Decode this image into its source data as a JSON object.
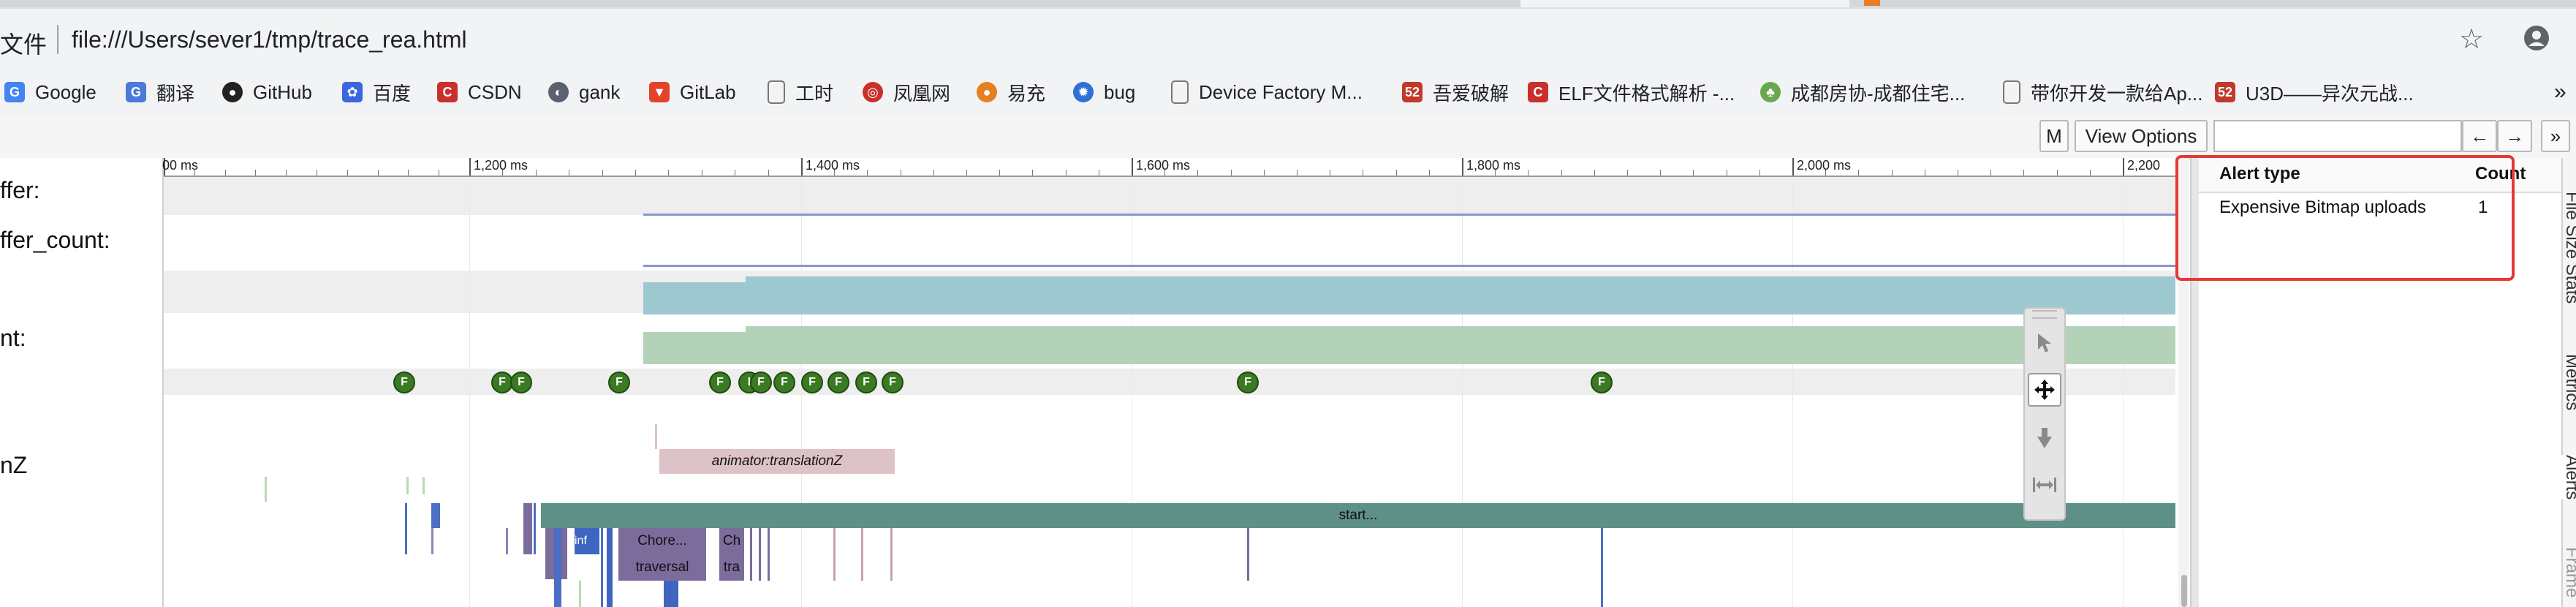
{
  "browser": {
    "address_prefix": "文件",
    "url": "file:///Users/sever1/tmp/trace_rea.html",
    "icons": [
      "star-icon",
      "account-icon",
      "more-icon"
    ]
  },
  "bookmarks": [
    {
      "label": "Google",
      "icon": "google-icon",
      "color": "#4285f4"
    },
    {
      "label": "翻译",
      "icon": "translate-icon",
      "color": "#4a7bd8"
    },
    {
      "label": "GitHub",
      "icon": "github-icon",
      "color": "#222222"
    },
    {
      "label": "百度",
      "icon": "baidu-icon",
      "color": "#3b66e0"
    },
    {
      "label": "CSDN",
      "icon": "csdn-icon",
      "color": "#c9302c"
    },
    {
      "label": "gank",
      "icon": "gank-icon",
      "color": "#5b6170"
    },
    {
      "label": "GitLab",
      "icon": "gitlab-icon",
      "color": "#e24329"
    },
    {
      "label": "工时",
      "icon": "page-icon",
      "color": "#777777"
    },
    {
      "label": "凤凰网",
      "icon": "ifeng-icon",
      "color": "#c9302c"
    },
    {
      "label": "易充",
      "icon": "yichong-icon",
      "color": "#e67e22"
    },
    {
      "label": "bug",
      "icon": "bug-icon",
      "color": "#2f6fd6"
    },
    {
      "label": "Device Factory M...",
      "icon": "page-icon",
      "color": "#777777"
    },
    {
      "label": "吾爱破解",
      "icon": "52pojie-icon",
      "color": "#c0392b"
    },
    {
      "label": "ELF文件格式解析 -...",
      "icon": "csdn-icon",
      "color": "#c9302c"
    },
    {
      "label": "成都房协-成都住宅...",
      "icon": "fangxie-icon",
      "color": "#6aa84f"
    },
    {
      "label": "带你开发一款给Ap...",
      "icon": "page-icon",
      "color": "#777777"
    },
    {
      "label": "U3D——异次元战...",
      "icon": "52pojie-icon",
      "color": "#c0392b"
    }
  ],
  "toolbar": {
    "m_label": "M",
    "view_options_label": "View Options",
    "search_placeholder": "",
    "prev_label": "←",
    "next_label": "→",
    "expand_label": "»",
    "help_label": "?"
  },
  "tracks": [
    {
      "label": "ffer:"
    },
    {
      "label": "ffer_count:"
    },
    {
      "label": "nt:"
    },
    {
      "label": "nZ"
    }
  ],
  "ruler": {
    "ticks": [
      "00 ms",
      "1,200 ms",
      "1,400 ms",
      "1,600 ms",
      "1,800 ms",
      "2,000 ms",
      "2,200"
    ]
  },
  "frame_markers": {
    "label": "F",
    "alt_label": "I"
  },
  "slices": {
    "animator": "animator:translationZ",
    "start": "start...",
    "inf": "inf",
    "choreographer": "Chore...",
    "traversal": "traversal",
    "choreographer_short": "Ch",
    "traversal_short": "tra"
  },
  "alerts": {
    "col_type": "Alert type",
    "col_count": "Count",
    "rows": [
      {
        "type": "Expensive Bitmap uploads",
        "count": "1"
      }
    ]
  },
  "side_tabs": [
    "File Size Stats",
    "Metrics",
    "Alerts",
    "Frame"
  ],
  "colors": {
    "frame_green": "#3a7a22",
    "teal_band": "#9ec8d0",
    "green_band": "#b3d2b8",
    "start_slice": "#5e9088",
    "animator_slice": "#ddc2c8",
    "choreographer_slice": "#7b6c9c",
    "highlight_red": "#e53935"
  }
}
